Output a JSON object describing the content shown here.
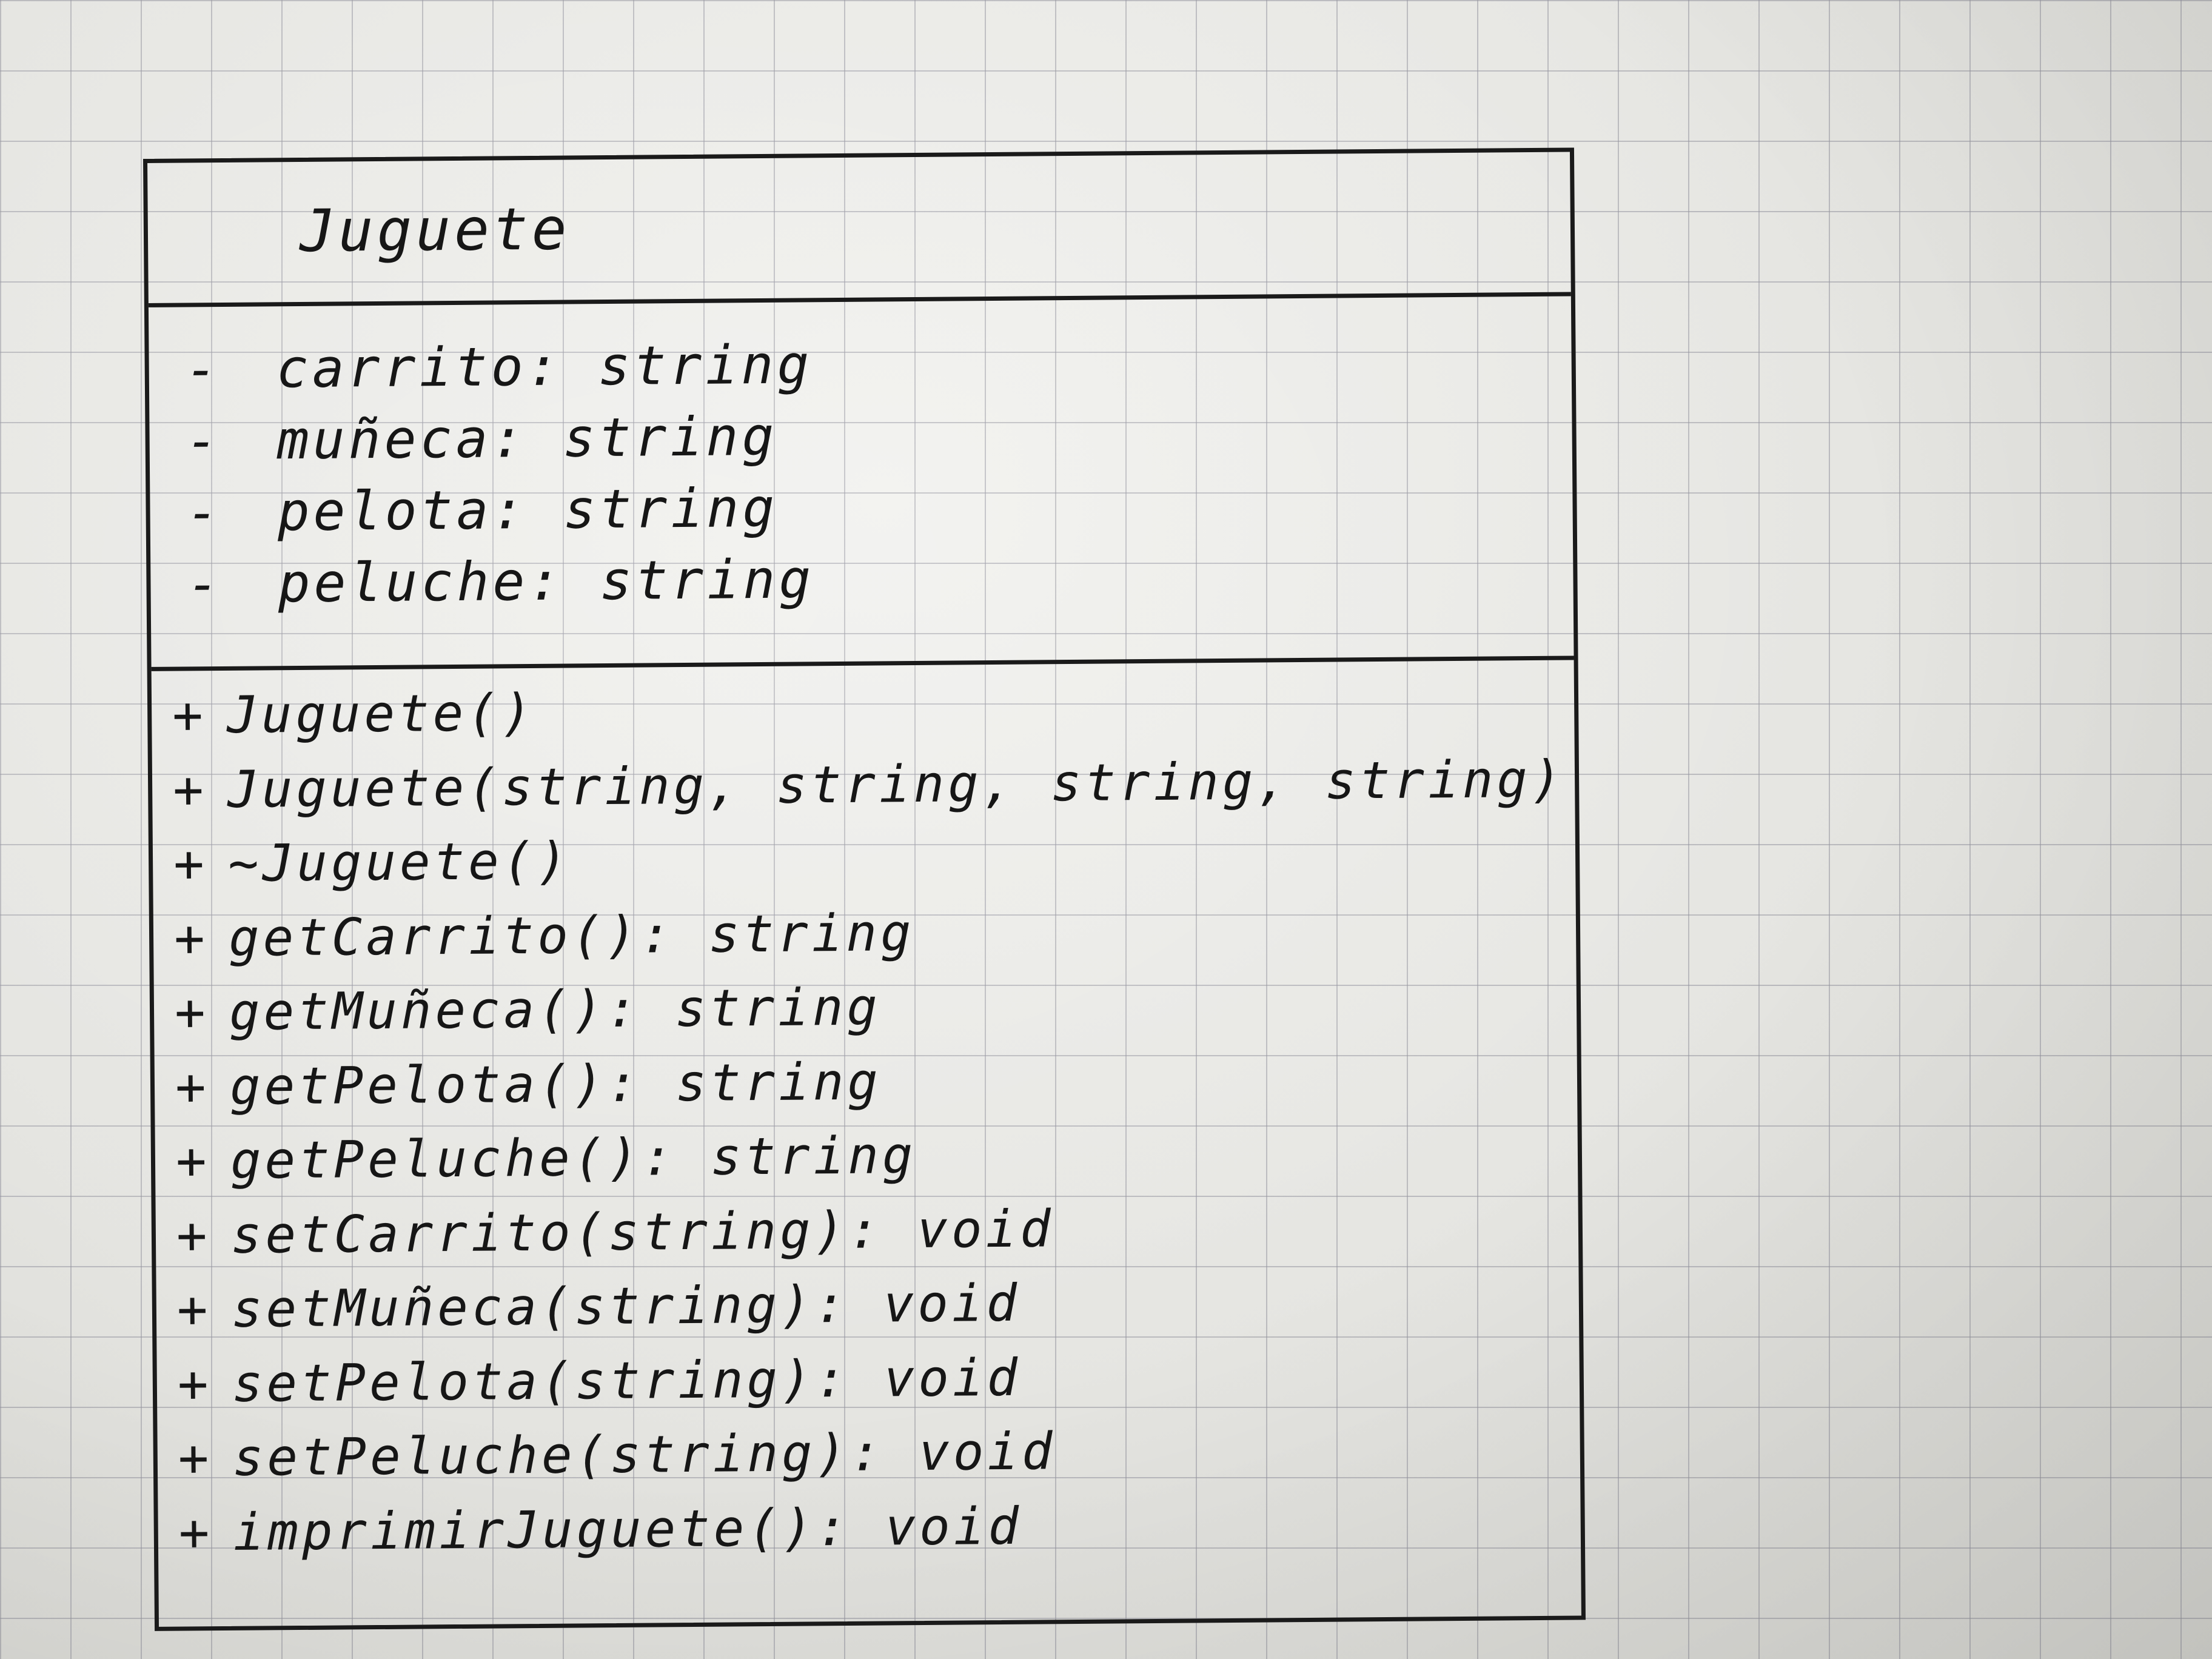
{
  "uml_class": {
    "name": "Juguete",
    "attributes": [
      {
        "visibility": "-",
        "text": "carrito: string"
      },
      {
        "visibility": "-",
        "text": "muñeca: string"
      },
      {
        "visibility": "-",
        "text": "pelota: string"
      },
      {
        "visibility": "-",
        "text": "peluche: string"
      }
    ],
    "operations": [
      {
        "visibility": "+",
        "text": "Juguete()"
      },
      {
        "visibility": "+",
        "text": "Juguete(string, string, string, string)"
      },
      {
        "visibility": "+",
        "text": "~Juguete()"
      },
      {
        "visibility": "+",
        "text": "getCarrito(): string"
      },
      {
        "visibility": "+",
        "text": "getMuñeca(): string"
      },
      {
        "visibility": "+",
        "text": "getPelota(): string"
      },
      {
        "visibility": "+",
        "text": "getPeluche(): string"
      },
      {
        "visibility": "+",
        "text": "setCarrito(string): void"
      },
      {
        "visibility": "+",
        "text": "setMuñeca(string): void"
      },
      {
        "visibility": "+",
        "text": "setPelota(string): void"
      },
      {
        "visibility": "+",
        "text": "setPeluche(string): void"
      },
      {
        "visibility": "+",
        "text": "imprimirJuguete(): void"
      }
    ]
  },
  "colors": {
    "ink": "#161616",
    "paper": "#e9e9e6",
    "grid": "#9696a0"
  }
}
